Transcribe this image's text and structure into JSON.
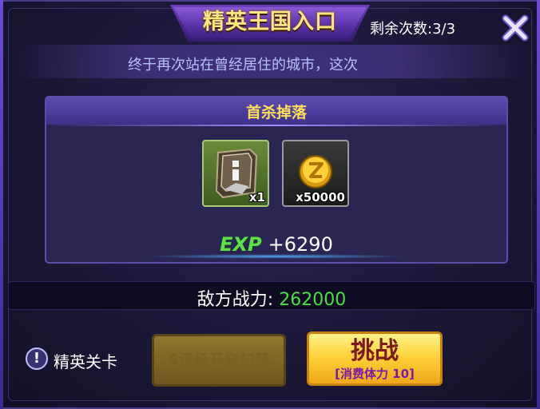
{
  "header": {
    "title": "精英王国入口",
    "remaining": "剩余次数:3/3"
  },
  "stage": {
    "description": "终于再次站在曾经居住的城市，这次"
  },
  "rewards": {
    "title": "首杀掉落",
    "items": [
      {
        "icon": "card-pack-icon",
        "count": "x1"
      },
      {
        "icon": "gold-coin-icon",
        "count": "x50000"
      }
    ],
    "exp_label": "EXP",
    "exp_value": "+6290"
  },
  "enemy": {
    "power_label": "敌方战力:",
    "power_value": "262000"
  },
  "footer": {
    "elite_icon": "!",
    "elite_label": "精英关卡",
    "sweep_label": "S评级开启扫荡",
    "challenge_label": "挑战",
    "challenge_cost": "[消费体力 10]"
  },
  "colors": {
    "title": "#ffe680",
    "reward_title": "#ffde5a",
    "exp": "#5ee04a",
    "power_value": "#46e046",
    "challenge_button": "#ffd23a"
  }
}
